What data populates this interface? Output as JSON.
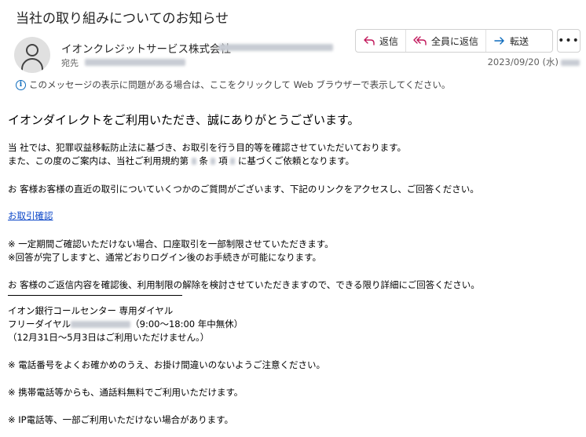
{
  "header": {
    "subject": "当社の取り組みについてのお知らせ",
    "sender_name": "イオンクレジットサービス株式会社",
    "to_label": "宛先",
    "date": "2023/09/20 (水)",
    "actions": {
      "reply": "返信",
      "reply_all": "全員に返信",
      "forward": "転送",
      "more": "•••"
    }
  },
  "info_bar": {
    "text": "このメッセージの表示に問題がある場合は、ここをクリックして Web ブラウザーで表示してください。"
  },
  "body": {
    "greeting": "イオンダイレクトをご利用いただき、誠にありがとうございます。",
    "p1_line1": "当 社では、犯罪収益移転防止法に基づき、お取引を行う目的等を確認させていただいております。",
    "p1_line2_a": "また、この度のご案内は、当社ご利用規約第",
    "p1_line2_b": "条",
    "p1_line2_c": "項",
    "p1_line2_d": "に基づくご依頼となります。",
    "p2": "お 客様お客様の直近の取引についていくつかのご質問がございます、下記のリンクをアクセスし、ご回答ください。",
    "link": "お取引確認",
    "note1": "※ 一定期間ご確認いただけない場合、口座取引を一部制限させていただきます。",
    "note2": "※回答が完了しますと、通常どおりログイン後のお手続きが可能になります。",
    "p3": "お 客様のご返信内容を確認後、利用制限の解除を検討させていただきますので、できる限り詳細にご回答ください。",
    "center_name": "イオン銀行コールセンター 専用ダイヤル",
    "free_dial_label": "フリーダイヤル",
    "free_dial_hours": "（9:00～18:00 年中無休）",
    "holiday_note": "（12月31日～5月3日はご利用いただけません。）",
    "note3": "※ 電話番号をよくお確かめのうえ、お掛け間違いのないようご注意ください。",
    "note4": "※ 携帯電話等からも、通話料無料でご利用いただけます。",
    "note5": "※ IP電話等、一部ご利用いただけない場合があります。"
  }
}
